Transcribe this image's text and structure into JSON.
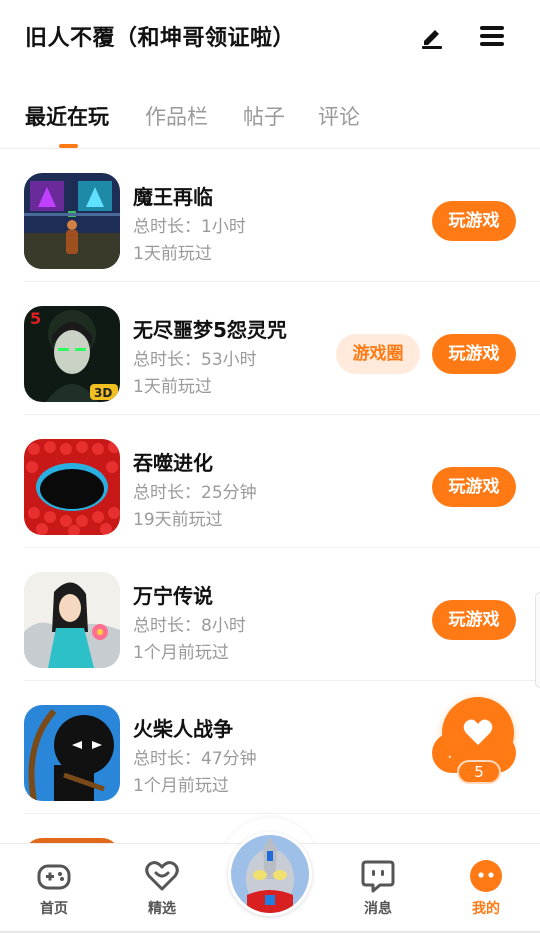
{
  "header": {
    "title": "旧人不覆（和坤哥领证啦）",
    "edit_icon": "edit-pen-icon",
    "menu_icon": "hamburger-menu-icon"
  },
  "tabs": [
    {
      "label": "最近在玩",
      "active": true
    },
    {
      "label": "作品栏",
      "active": false
    },
    {
      "label": "帖子",
      "active": false
    },
    {
      "label": "评论",
      "active": false
    }
  ],
  "games": [
    {
      "name": "魔王再临",
      "duration": "总时长：1小时",
      "last_played": "1天前玩过",
      "play_label": "玩游戏",
      "icon": "demon-king-game-icon"
    },
    {
      "name": "无尽噩梦5怨灵咒",
      "duration": "总时长：53小时",
      "last_played": "1天前玩过",
      "play_label": "玩游戏",
      "circle_label": "游戏圈",
      "icon": "endless-nightmare-game-icon"
    },
    {
      "name": "吞噬进化",
      "duration": "总时长：25分钟",
      "last_played": "19天前玩过",
      "play_label": "玩游戏",
      "icon": "devour-evolution-game-icon"
    },
    {
      "name": "万宁传说",
      "duration": "总时长：8小时",
      "last_played": "1个月前玩过",
      "play_label": "玩游戏",
      "icon": "wanning-legend-game-icon"
    },
    {
      "name": "火柴人战争",
      "duration": "总时长：47分钟",
      "last_played": "1个月前玩过",
      "play_label": "玩游戏",
      "icon": "stickman-war-game-icon"
    }
  ],
  "like_fab": {
    "count": "5",
    "icon": "heart-icon"
  },
  "bottom_nav": [
    {
      "label": "首页",
      "icon": "gamepad-icon",
      "active": false
    },
    {
      "label": "精选",
      "icon": "heart-smile-icon",
      "active": false
    },
    {
      "label": "消息",
      "icon": "chat-bubble-icon",
      "active": false
    },
    {
      "label": "我的",
      "icon": "profile-face-icon",
      "active": true
    }
  ],
  "center_avatar": {
    "icon": "ultraman-avatar"
  },
  "colors": {
    "accent": "#ff7a14",
    "accent_light": "#ffeadb",
    "text_primary": "#111111",
    "text_secondary": "#9a9a9a"
  }
}
